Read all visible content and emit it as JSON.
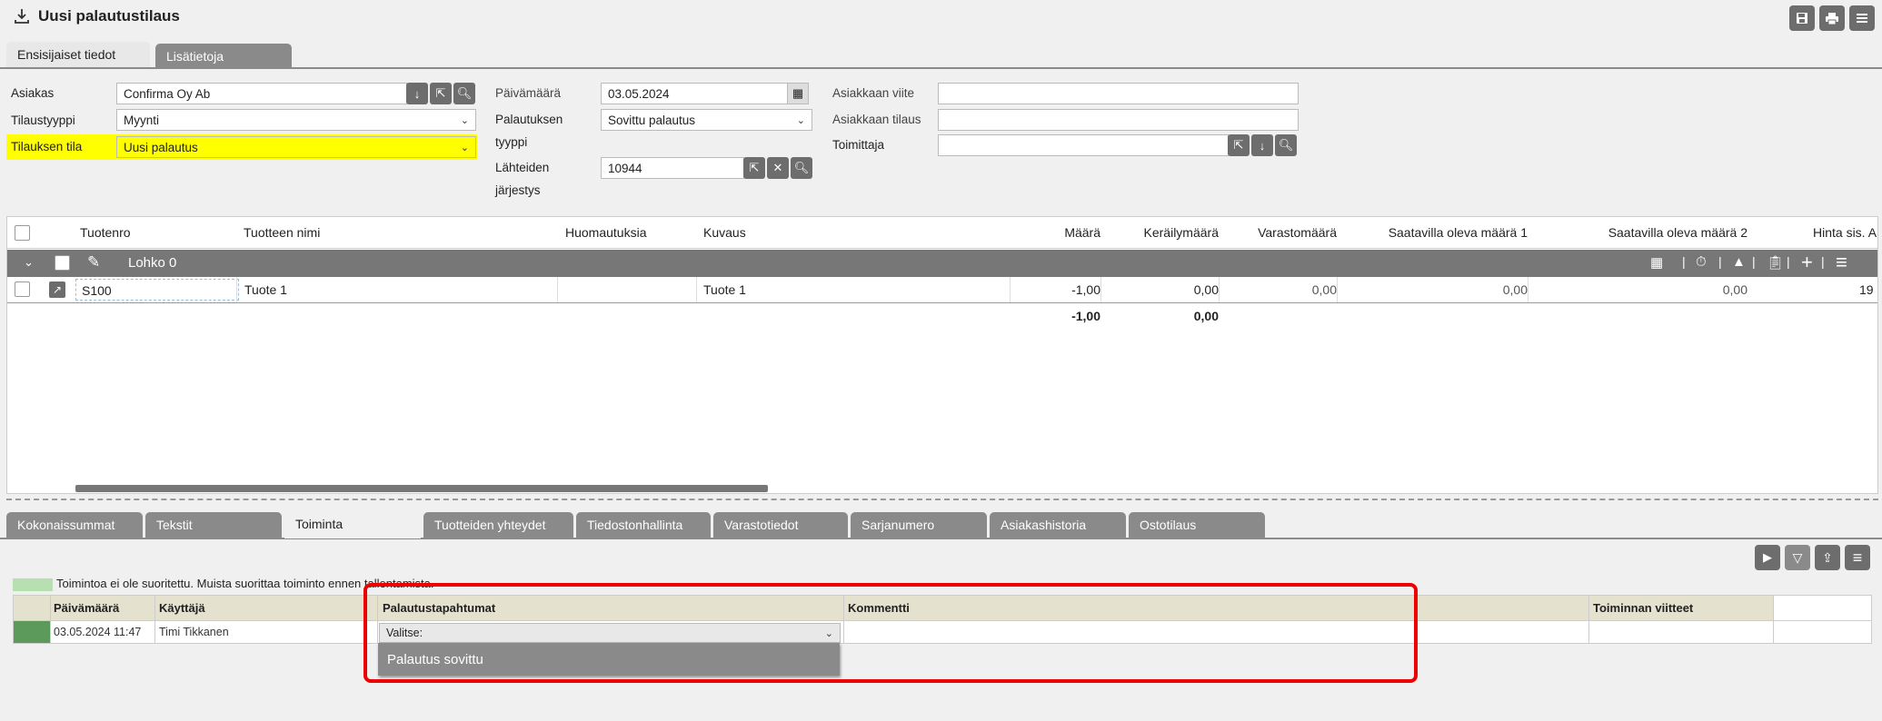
{
  "app": {
    "title": "Uusi palautustilaus"
  },
  "header_buttons": [
    "save-icon",
    "print-icon",
    "menu-icon"
  ],
  "top_tabs": [
    {
      "label": "Ensisijaiset tiedot",
      "active": true
    },
    {
      "label": "Lisätietoja",
      "active": false
    }
  ],
  "form": {
    "asiakas_label": "Asiakas",
    "asiakas_value": "Confirma Oy Ab",
    "tilaustyyppi_label": "Tilaustyyppi",
    "tilaustyyppi_value": "Myynti",
    "tilauksen_tila_label": "Tilauksen tila",
    "tilauksen_tila_value": "Uusi palautus",
    "paivamaara_label": "Päivämäärä",
    "paivamaara_value": "03.05.2024",
    "palautuksen_tyyppi_label_1": "Palautuksen",
    "palautuksen_tyyppi_label_2": "tyyppi",
    "palautuksen_tyyppi_value": "Sovittu palautus",
    "lahteiden_label_1": "Lähteiden",
    "lahteiden_label_2": "järjestys",
    "lahteiden_value": "10944",
    "asiakkaan_viite_label": "Asiakkaan viite",
    "asiakkaan_viite_value": "",
    "asiakkaan_tilaus_label": "Asiakkaan tilaus",
    "asiakkaan_tilaus_value": "",
    "toimittaja_label": "Toimittaja",
    "toimittaja_value": "",
    "highlight_color": "#ffff00"
  },
  "grid": {
    "columns": [
      "Tuotenro",
      "Tuotteen nimi",
      "Huomautuksia",
      "Kuvaus",
      "Määrä",
      "Keräilymäärä",
      "Varastomäärä",
      "Saatavilla oleva määrä 1",
      "Saatavilla oleva määrä 2",
      "Hinta sis. A"
    ],
    "group_label": "Lohko 0",
    "rows": [
      {
        "tuotenro": "S100",
        "nimi": "Tuote 1",
        "huom": "",
        "kuvaus": "Tuote 1",
        "maara": "-1,00",
        "kerailymaara": "0,00",
        "varastomaara": "0,00",
        "saatavilla1": "0,00",
        "saatavilla2": "0,00",
        "hinta": "19"
      }
    ],
    "totals": {
      "maara": "-1,00",
      "kerailymaara": "0,00"
    }
  },
  "bottom_tabs": [
    {
      "label": "Kokonaissummat",
      "active": false
    },
    {
      "label": "Tekstit",
      "active": false
    },
    {
      "label": "Toiminta",
      "active": true
    },
    {
      "label": "Tuotteiden yhteydet",
      "active": false
    },
    {
      "label": "Tiedostonhallinta",
      "active": false
    },
    {
      "label": "Varastotiedot",
      "active": false
    },
    {
      "label": "Sarjanumero",
      "active": false
    },
    {
      "label": "Asiakashistoria",
      "active": false
    },
    {
      "label": "Ostotilaus",
      "active": false
    }
  ],
  "activity": {
    "notice": "Toimintoa ei ole suoritettu. Muista suorittaa toiminto ennen tallentamista.",
    "notice_color": "#b6e0b0",
    "columns": [
      "Päivämäärä",
      "Käyttäjä",
      "Palautustapahtumat",
      "Kommentti",
      "Toiminnan viitteet"
    ],
    "row": {
      "paivamaara": "03.05.2024 11:47",
      "kayttaja": "Timi Tikkanen",
      "select_placeholder": "Valitse:",
      "kommentti": "",
      "viitteet": ""
    },
    "dropdown_option": "Palautus sovittu",
    "status_color": "#5c9a5c"
  },
  "accent": {
    "button_bg": "#6d6d6d",
    "highlight_box": "#e00000"
  }
}
